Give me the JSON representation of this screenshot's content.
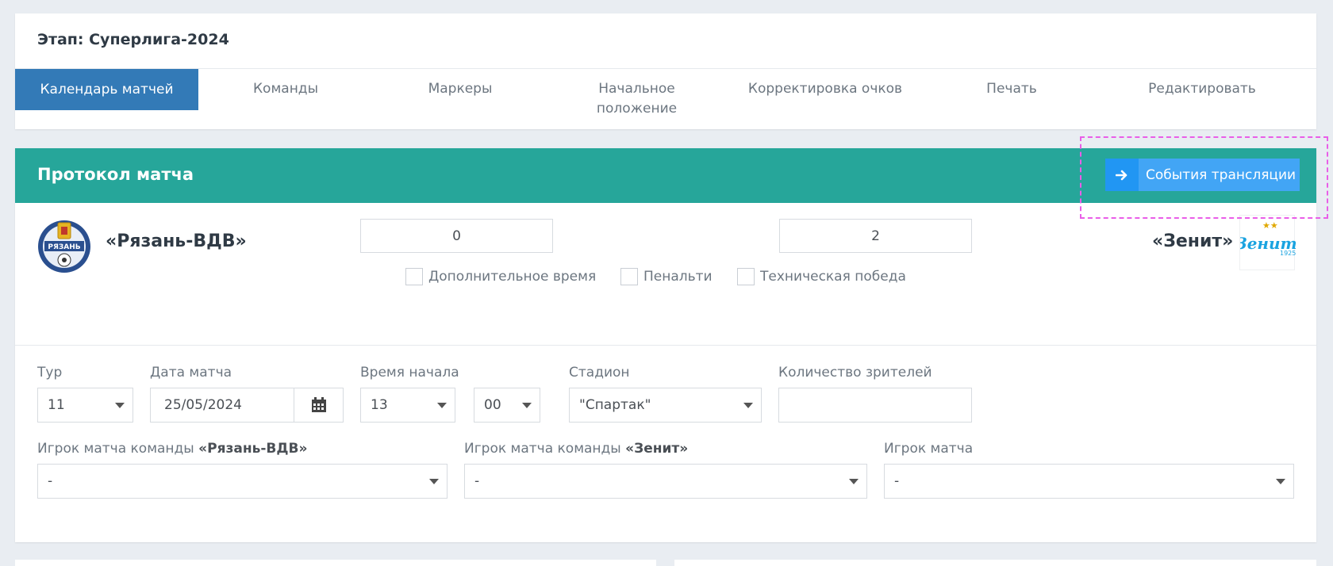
{
  "stage": {
    "title": "Этап: Суперлига-2024"
  },
  "tabs": [
    {
      "label": "Календарь матчей"
    },
    {
      "label": "Команды"
    },
    {
      "label": "Маркеры"
    },
    {
      "label": "Начальное положение"
    },
    {
      "label": "Корректировка очков"
    },
    {
      "label": "Печать"
    },
    {
      "label": "Редактировать"
    }
  ],
  "protocol": {
    "title": "Протокол матча",
    "broadcast_button": "События трансляции"
  },
  "match": {
    "home_team": "«Рязань-ВДВ»",
    "away_team": "«Зенит»",
    "home_score": "0",
    "away_score": "2",
    "home_logo_text": "РЯЗАНЬ",
    "away_logo_text": "Зенит",
    "away_logo_year": "1925"
  },
  "options": {
    "extra_time": "Дополнительное время",
    "penalties": "Пенальти",
    "technical_win": "Техническая победа"
  },
  "form": {
    "round_label": "Тур",
    "round_value": "11",
    "date_label": "Дата матча",
    "date_value": "25/05/2024",
    "time_label": "Время начала",
    "hour_value": "13",
    "minute_value": "00",
    "stadium_label": "Стадион",
    "stadium_value": "\"Спартак\"",
    "spectators_label": "Количество зрителей",
    "spectators_value": "",
    "home_player_label_prefix": "Игрок матча команды ",
    "home_player_label_team": "«Рязань-ВДВ»",
    "away_player_label_prefix": "Игрок матча команды ",
    "away_player_label_team": "«Зенит»",
    "match_player_label": "Игрок матча",
    "home_player_value": "-",
    "away_player_value": "-",
    "match_player_value": "-"
  },
  "colors": {
    "header_teal": "#26a69a",
    "active_tab_blue": "#337ab7",
    "button_blue": "#42a5f5",
    "highlight_pink": "#e95ee8"
  }
}
